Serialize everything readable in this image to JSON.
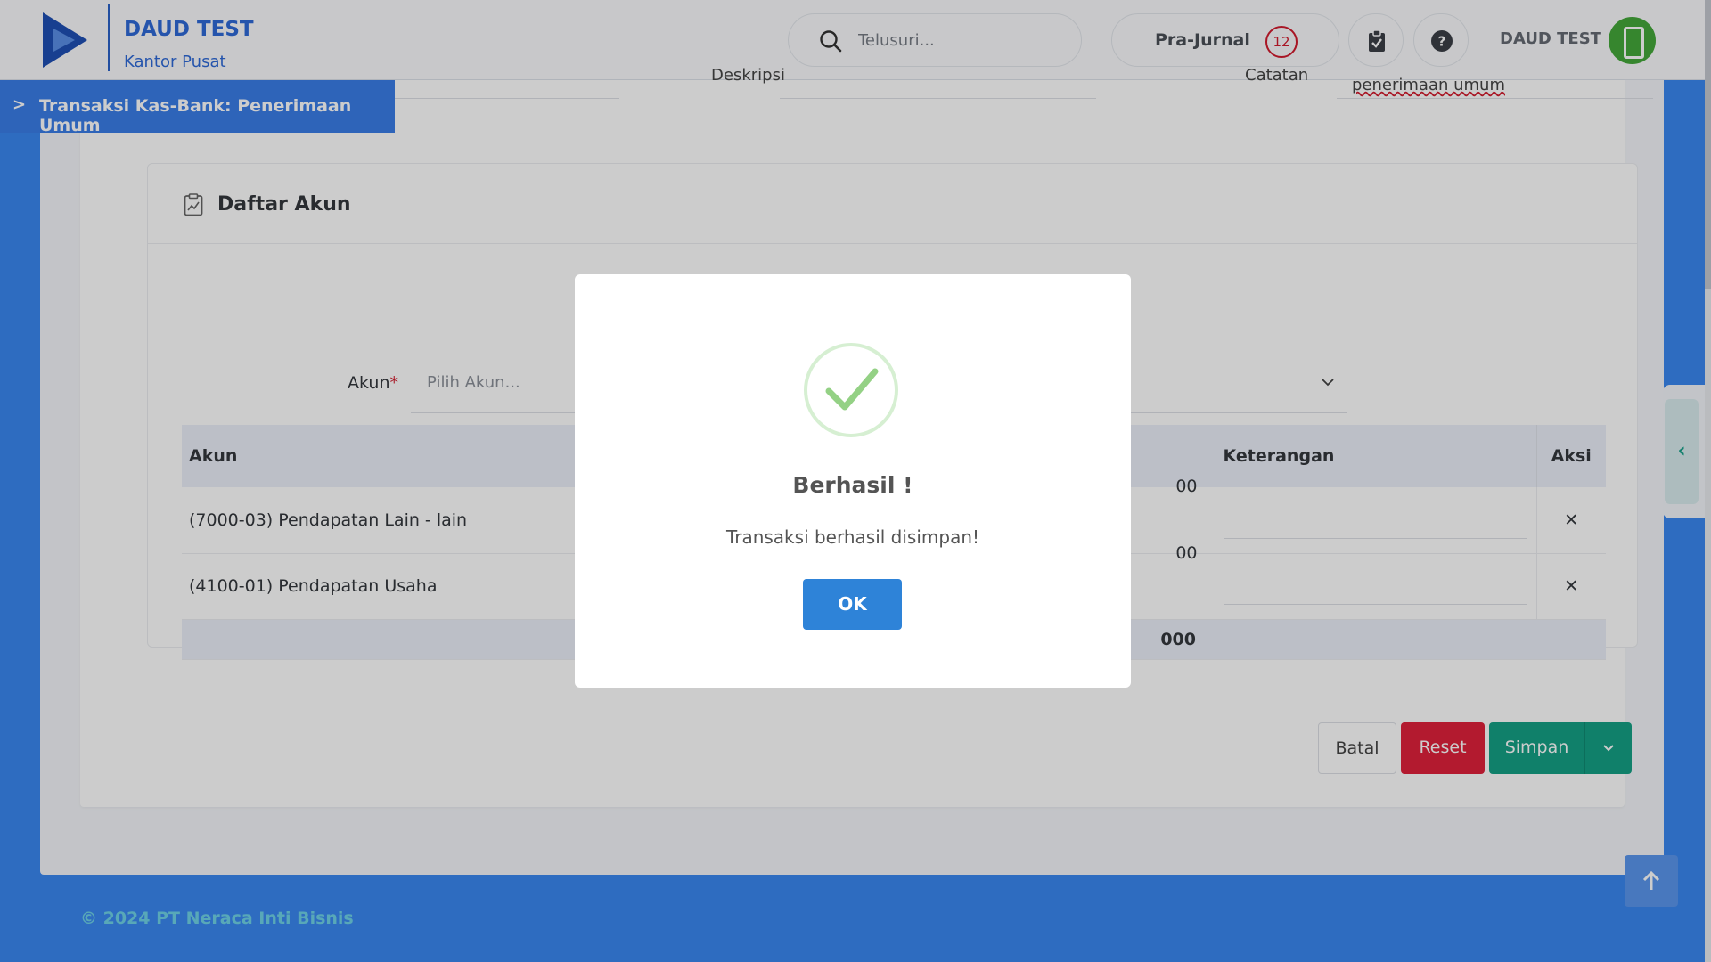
{
  "header": {
    "company": "DAUD TEST",
    "branch": "Kantor Pusat",
    "search_placeholder": "Telusuri...",
    "prajurnal_label": "Pra-Jurnal",
    "prajurnal_count": "12",
    "user_name": "DAUD TEST",
    "icons": [
      "logo-icon",
      "search-icon",
      "clipboard-check-icon",
      "help-icon",
      "avatar-device-icon"
    ]
  },
  "breadcrumb": {
    "arrow": ">",
    "title": "Transaksi Kas-Bank: Penerimaan Umum"
  },
  "form_top": {
    "deskripsi_label": "Deskripsi",
    "catatan_label": "Catatan",
    "catatan_value": "penerimaan umum"
  },
  "daftar_akun": {
    "title": "Daftar Akun",
    "akun_label": "Akun",
    "required_mark": "*",
    "akun_placeholder": "Pilih Akun...",
    "columns": {
      "akun": "Akun",
      "keterangan": "Keterangan",
      "aksi": "Aksi"
    },
    "rows": [
      {
        "akun": "(7000-03) Pendapatan Lain - lain",
        "amount_tail": "00",
        "keterangan": ""
      },
      {
        "akun": "(4100-01) Pendapatan Usaha",
        "amount_tail": "00",
        "keterangan": ""
      }
    ],
    "total_tail": "000",
    "delete_glyph": "✕"
  },
  "actions": {
    "batal": "Batal",
    "reset": "Reset",
    "simpan": "Simpan"
  },
  "side_toggle_glyph": "‹",
  "footer": "© 2024 PT Neraca Inti Bisnis",
  "dialog": {
    "title": "Berhasil !",
    "message": "Transaksi berhasil disimpan!",
    "ok": "OK"
  },
  "colors": {
    "primary": "#3a87f0",
    "success": "#14a085",
    "danger": "#e0213b",
    "ok_button": "#2e83d8"
  }
}
